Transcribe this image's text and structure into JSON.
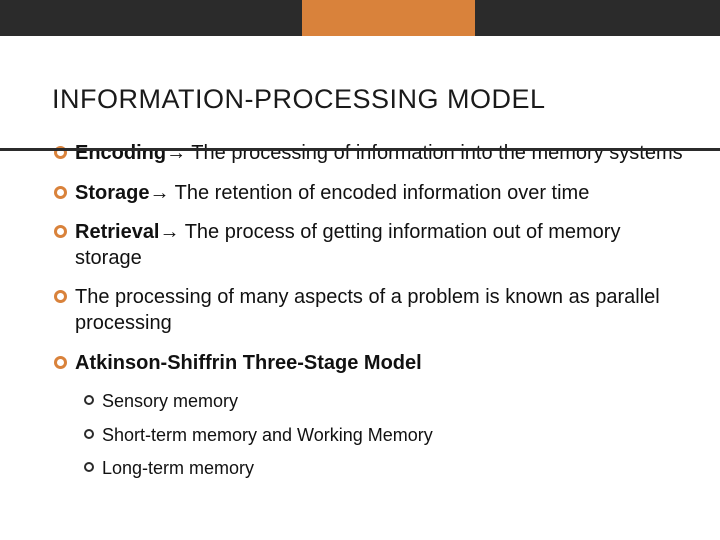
{
  "title": "INFORMATION-PROCESSING MODEL",
  "bullets": [
    {
      "bold": "Encoding",
      "arrow": "→",
      "rest": " The processing of information into the memory systems"
    },
    {
      "bold": "Storage",
      "arrow": "→",
      "rest": " The retention of encoded information over time"
    },
    {
      "bold": "Retrieval",
      "arrow": "→",
      "rest": " The process of getting information out of memory storage"
    },
    {
      "plain": "The processing of many aspects of a problem is known as parallel processing"
    },
    {
      "bold": "Atkinson-Shiffrin Three-Stage Model"
    }
  ],
  "subbullets": [
    "Sensory memory",
    "Short-term memory and Working Memory",
    "Long-term memory"
  ],
  "colors": {
    "accent": "#d9823b",
    "dark": "#2b2b2b"
  }
}
